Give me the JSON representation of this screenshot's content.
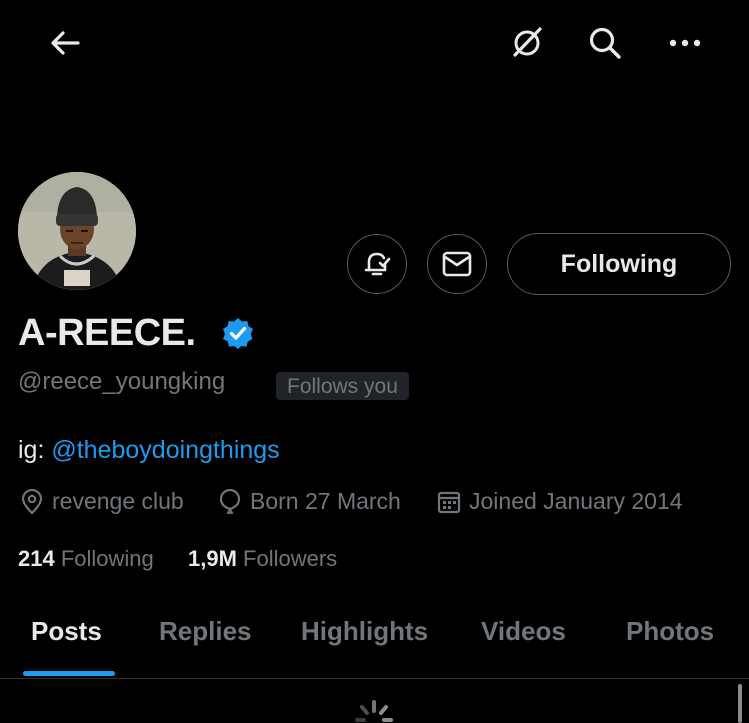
{
  "header": {
    "back_icon": "arrow-left-icon",
    "grok_icon": "grok-icon",
    "search_icon": "search-icon",
    "more_icon": "more-horizontal-icon"
  },
  "profile": {
    "display_name": "A-REECE.",
    "verified": true,
    "handle": "@reece_youngking",
    "follows_you": "Follows you",
    "bio_prefix": "ig: ",
    "bio_link": "@theboydoingthings",
    "location": "revenge club",
    "birthday": "Born 27 March",
    "joined": "Joined January 2014",
    "following_count": "214",
    "following_label": "Following",
    "followers_count": "1,9M",
    "followers_label": "Followers"
  },
  "actions": {
    "notify_icon": "bell-check-icon",
    "message_icon": "envelope-icon",
    "following_button": "Following"
  },
  "tabs": [
    {
      "label": "Posts",
      "active": true
    },
    {
      "label": "Replies",
      "active": false
    },
    {
      "label": "Highlights",
      "active": false
    },
    {
      "label": "Videos",
      "active": false
    },
    {
      "label": "Photos",
      "active": false
    }
  ],
  "colors": {
    "background": "#000000",
    "accent": "#1d9bf0",
    "text_primary": "#e7e9ea",
    "text_secondary": "#71767b",
    "border": "#53595e"
  }
}
